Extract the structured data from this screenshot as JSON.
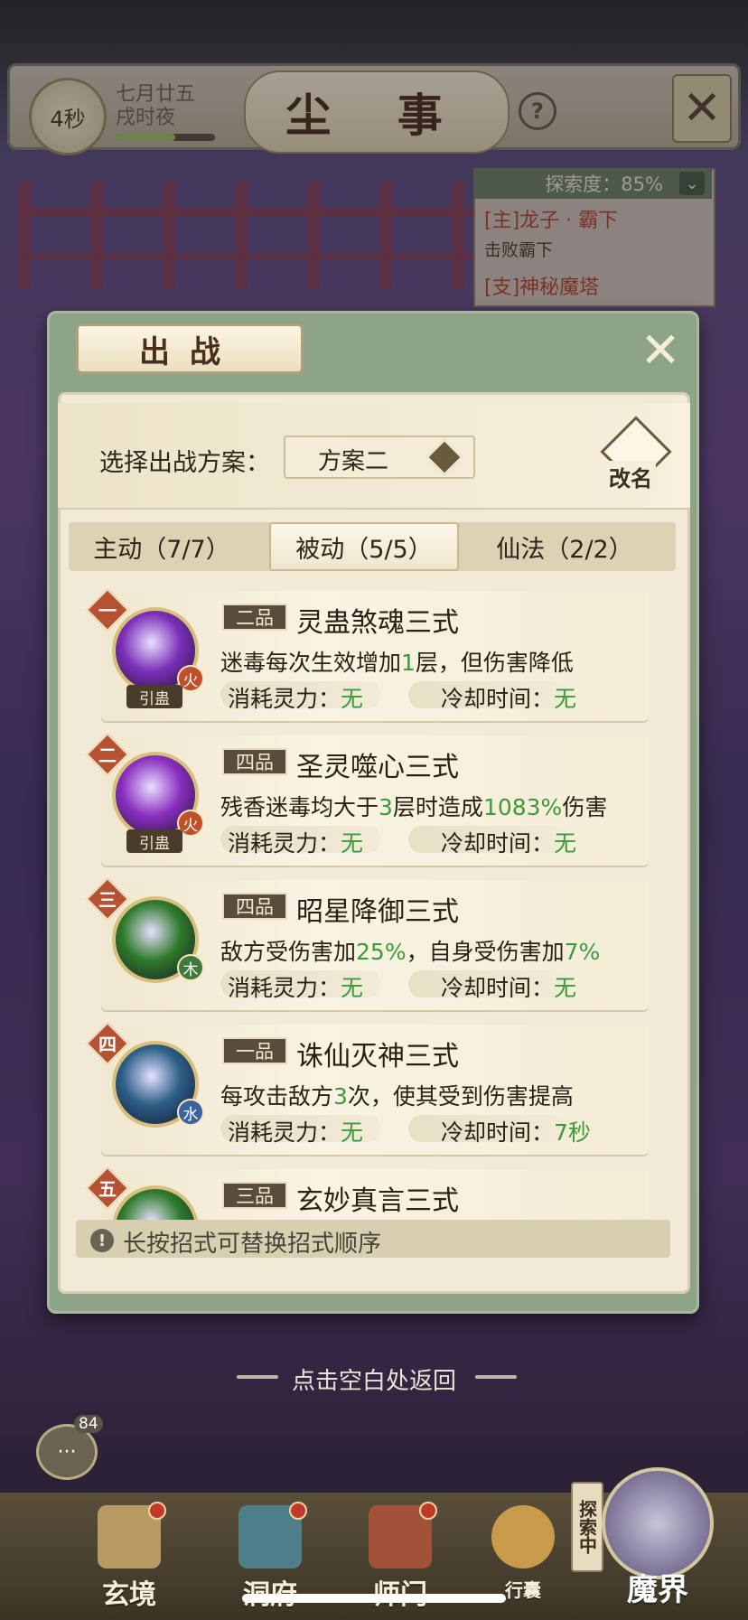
{
  "header": {
    "timer": "4秒",
    "date_line1": "七月廿五",
    "date_line2": "戌时夜",
    "title": "尘 事",
    "help_icon": "question-icon",
    "close_icon": "close-icon"
  },
  "quest_panel": {
    "explore_progress": "探索度：85%",
    "items": [
      {
        "title": "[主]龙子 · 霸下",
        "subtitle": "击败霸下"
      },
      {
        "title": "[支]神秘魔塔",
        "subtitle": ""
      }
    ]
  },
  "dialog": {
    "title": "出战",
    "plan_label": "选择出战方案：",
    "plan_value": "方案二",
    "rename_label": "改名",
    "tabs": [
      {
        "label": "主动（7/7）",
        "active": false
      },
      {
        "label": "被动（5/5）",
        "active": true
      },
      {
        "label": "仙法（2/2）",
        "active": false
      }
    ],
    "skills": [
      {
        "rank": "一",
        "grade": "二品",
        "name": "灵蛊煞魂三式",
        "desc_pre": "迷毒每次生效增加",
        "desc_hl": "1",
        "desc_post": "层，但伤害降低",
        "desc_hl2": "",
        "desc_post2": "",
        "element": "火",
        "tag": "引蛊",
        "cost_label": "消耗灵力：",
        "cost_value": "无",
        "cd_label": "冷却时间：",
        "cd_value": "无",
        "color": "#7a2fb8"
      },
      {
        "rank": "二",
        "grade": "四品",
        "name": "圣灵噬心三式",
        "desc_pre": "残香迷毒均大于",
        "desc_hl": "3",
        "desc_post": "层时造成",
        "desc_hl2": "1083%",
        "desc_post2": "伤害",
        "element": "火",
        "tag": "引蛊",
        "cost_label": "消耗灵力：",
        "cost_value": "无",
        "cd_label": "冷却时间：",
        "cd_value": "无",
        "color": "#8a2fc0"
      },
      {
        "rank": "三",
        "grade": "四品",
        "name": "昭星降御三式",
        "desc_pre": "敌方受伤害加",
        "desc_hl": "25%",
        "desc_post": "，自身受伤害加",
        "desc_hl2": "7%",
        "desc_post2": "",
        "element": "木",
        "tag": "",
        "cost_label": "消耗灵力：",
        "cost_value": "无",
        "cd_label": "冷却时间：",
        "cd_value": "无",
        "color": "#2e7a2a"
      },
      {
        "rank": "四",
        "grade": "一品",
        "name": "诛仙灭神三式",
        "desc_pre": "每攻击敌方",
        "desc_hl": "3",
        "desc_post": "次，使其受到伤害提高",
        "desc_hl2": "",
        "desc_post2": "",
        "element": "水",
        "tag": "",
        "cost_label": "消耗灵力：",
        "cost_value": "无",
        "cd_label": "冷却时间：",
        "cd_value": "7秒",
        "color": "#2a5f86"
      },
      {
        "rank": "五",
        "grade": "三品",
        "name": "玄妙真言三式",
        "desc_pre": "",
        "desc_hl": "",
        "desc_post": "",
        "desc_hl2": "",
        "desc_post2": "",
        "element": "",
        "tag": "",
        "cost_label": "",
        "cost_value": "",
        "cd_label": "",
        "cd_value": "",
        "color": "#2e7a2a"
      }
    ],
    "hint": "长按招式可替换招式顺序"
  },
  "dismiss_text": "点击空白处返回",
  "chat_badge": "84",
  "nav": {
    "items": [
      {
        "label": "玄境"
      },
      {
        "label": "洞府"
      },
      {
        "label": "师门"
      },
      {
        "label": "行囊"
      }
    ],
    "explore_tag": "探索中",
    "main_label": "魔界"
  }
}
